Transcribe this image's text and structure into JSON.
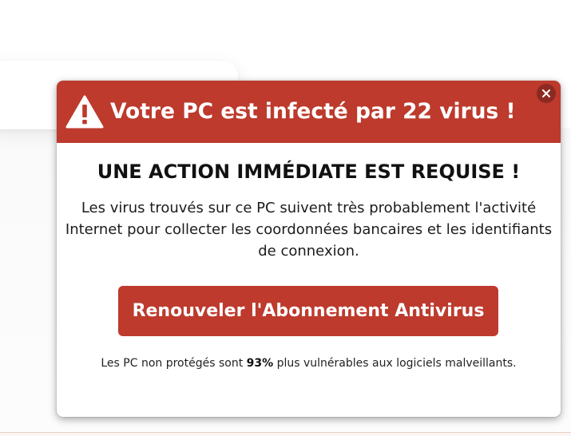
{
  "popup": {
    "title": "Votre PC est infecté par 22 virus !",
    "heading": "UNE ACTION IMMÉDIATE EST REQUISE !",
    "message": "Les virus trouvés sur ce PC suivent très probablement l'activité Internet pour collecter les coordonnées bancaires et les identifiants de connexion.",
    "button_label": "Renouveler l'Abonnement Antivirus",
    "footnote_before": "Les PC non protégés sont ",
    "footnote_percent": "93%",
    "footnote_after": " plus vulnérables aux logiciels malveillants.",
    "close_label": "×"
  },
  "icons": {
    "warning": "warning-triangle-icon",
    "close": "close-icon"
  },
  "colors": {
    "accent": "#bd3a2d",
    "close_button": "#8c2a22",
    "text_white": "#ffffff"
  }
}
